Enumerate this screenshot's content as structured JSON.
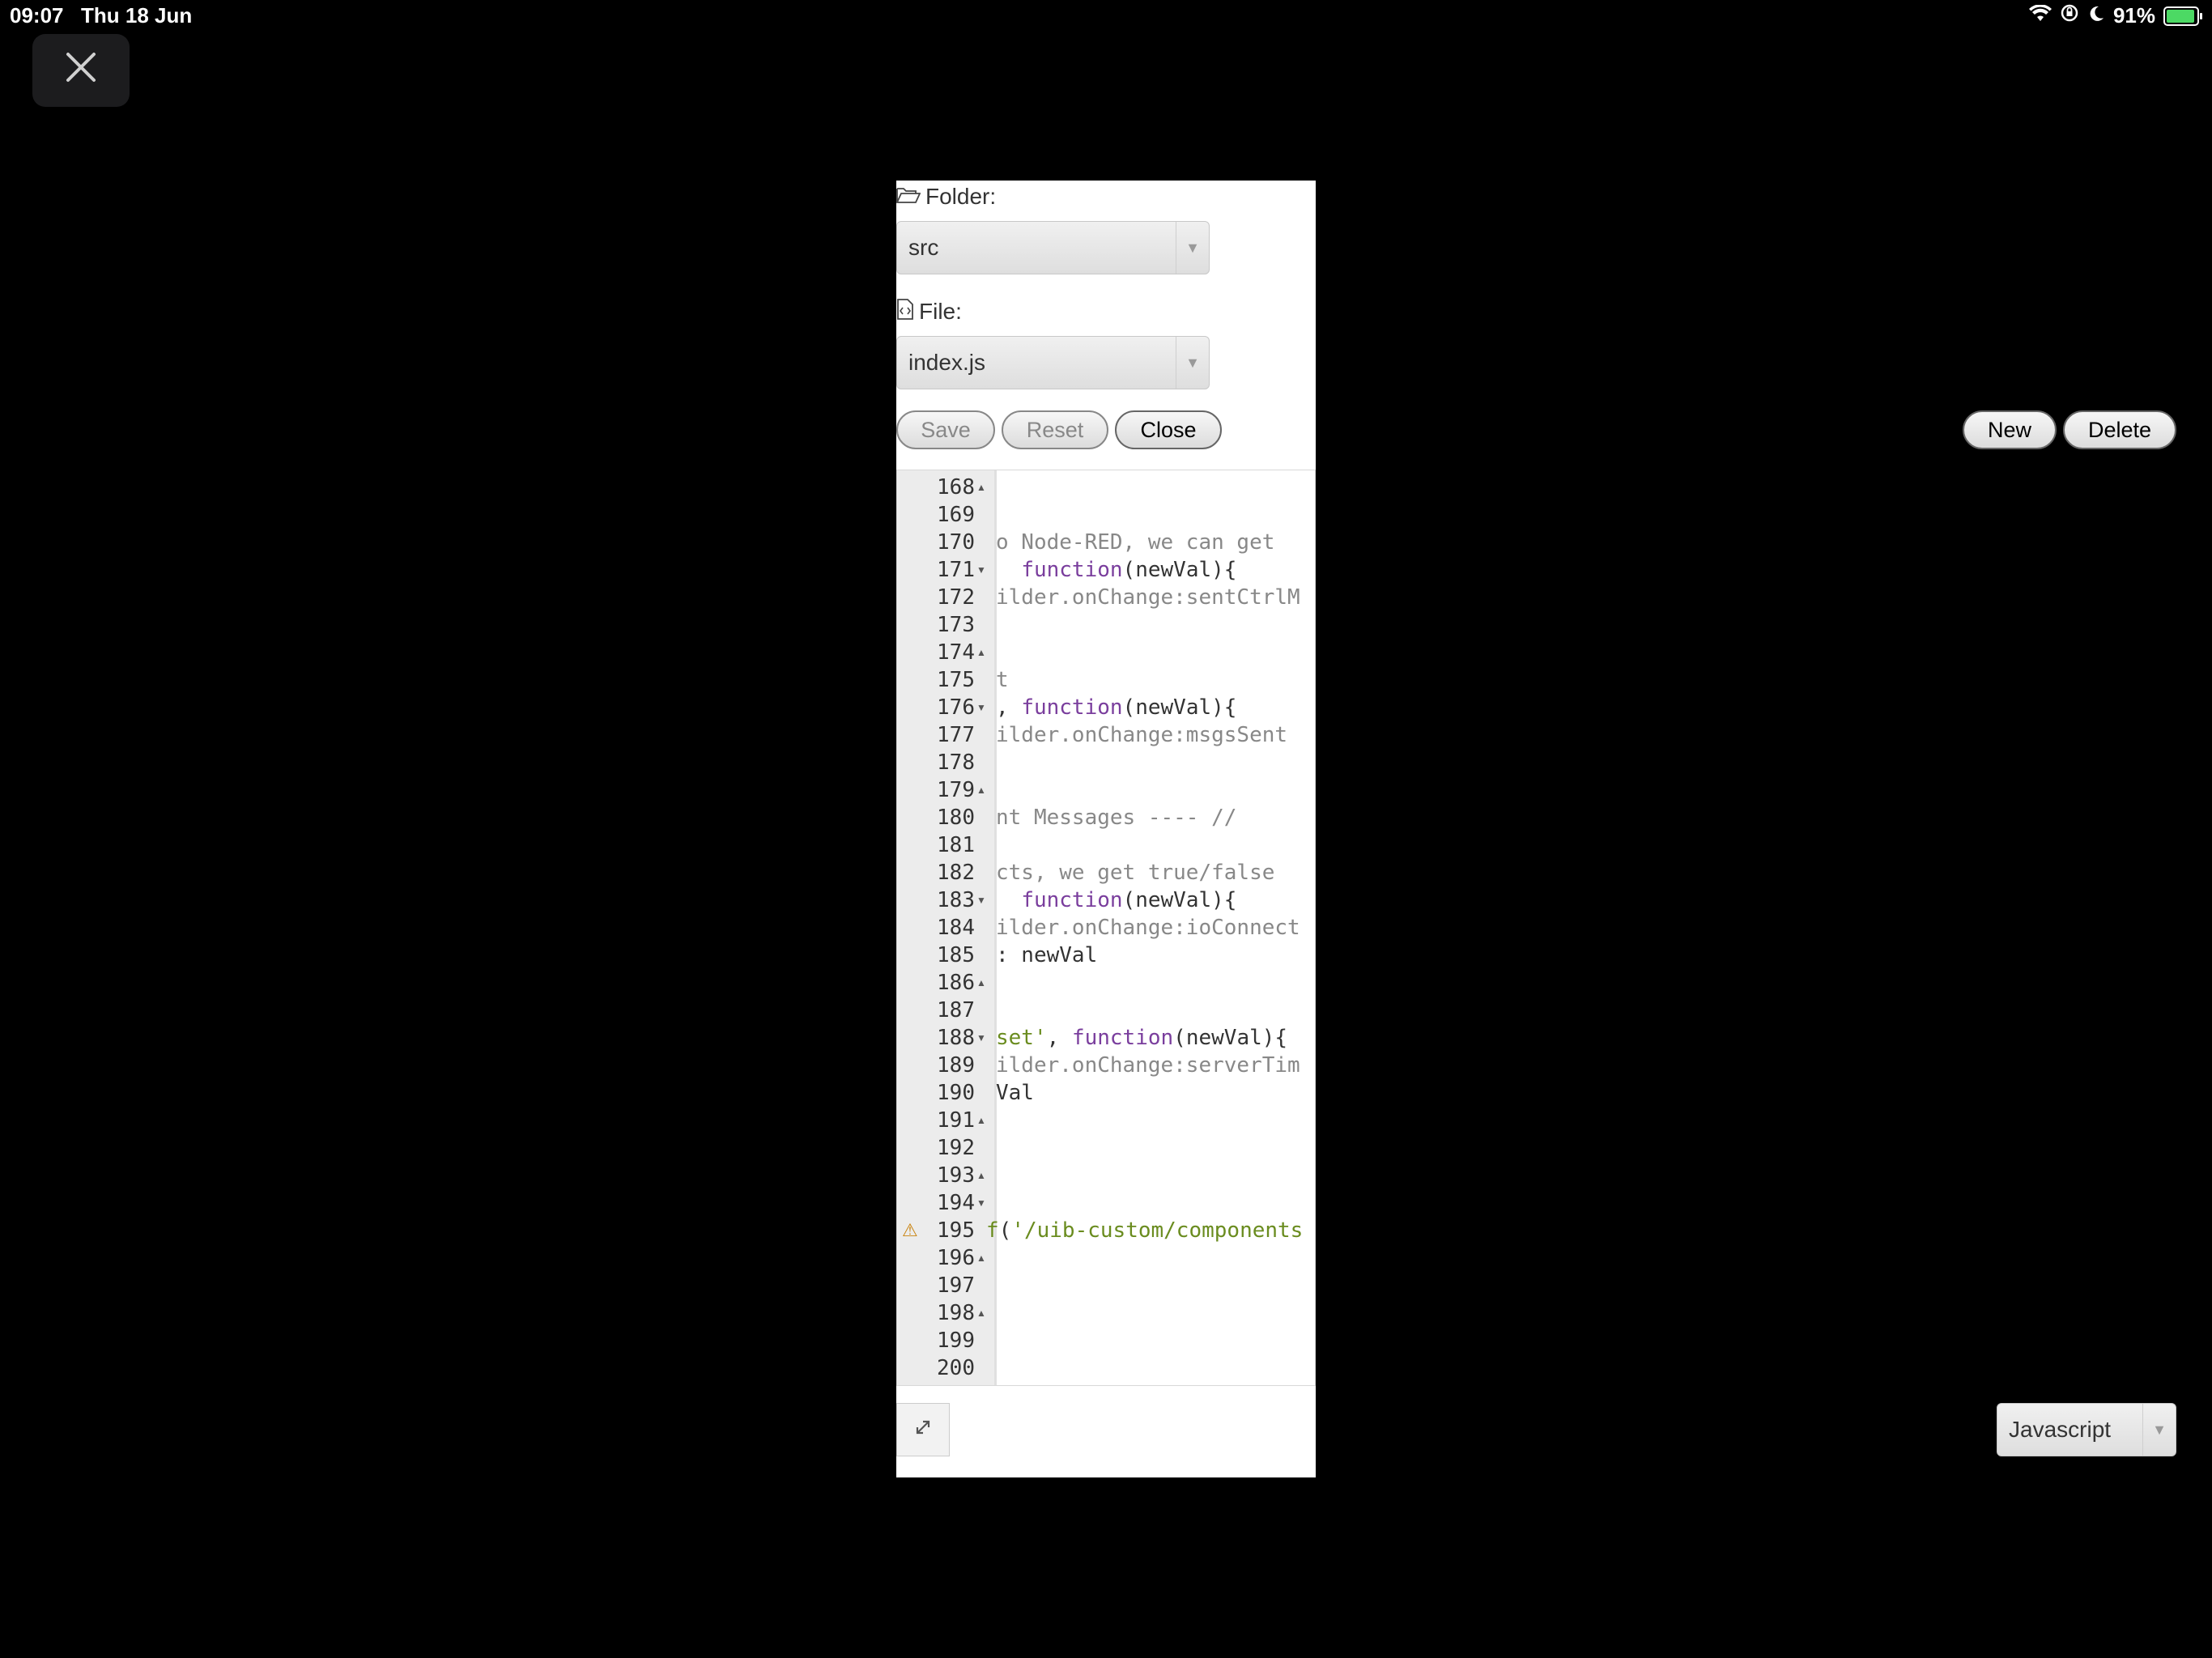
{
  "status_bar": {
    "time": "09:07",
    "date": "Thu 18 Jun",
    "battery": "91%",
    "icons": [
      "wifi-icon",
      "orientation-lock-icon",
      "moon-icon",
      "battery-charging-icon"
    ]
  },
  "overlay": {
    "close_icon": "close-icon"
  },
  "folder": {
    "label": "Folder:",
    "value": "src",
    "icon": "folder-open-icon"
  },
  "file": {
    "label": "File:",
    "value": "index.js",
    "icon": "code-file-icon"
  },
  "buttons": {
    "save": "Save",
    "reset": "Reset",
    "close": "Close",
    "new": "New",
    "delete": "Delete"
  },
  "language": {
    "value": "Javascript"
  },
  "editor": {
    "lines": [
      {
        "n": "168",
        "fold": "up",
        "text": "",
        "cls": ""
      },
      {
        "n": "169",
        "fold": "",
        "text": "",
        "cls": ""
      },
      {
        "n": "170",
        "fold": "",
        "text": "o Node-RED, we can get ",
        "cls": "comment"
      },
      {
        "n": "171",
        "fold": "down",
        "text": "",
        "cls": "fn",
        "pre": "  ",
        "kw": "function",
        "post": "(newVal){"
      },
      {
        "n": "172",
        "fold": "",
        "text": "ilder.onChange:sentCtrlM",
        "cls": "comment"
      },
      {
        "n": "173",
        "fold": "",
        "text": "",
        "cls": ""
      },
      {
        "n": "174",
        "fold": "up",
        "text": "",
        "cls": ""
      },
      {
        "n": "175",
        "fold": "",
        "text": "t",
        "cls": "comment"
      },
      {
        "n": "176",
        "fold": "down",
        "text": "",
        "cls": "fn",
        "pre": ", ",
        "kw": "function",
        "post": "(newVal){"
      },
      {
        "n": "177",
        "fold": "",
        "text": "ilder.onChange:msgsSent",
        "cls": "comment"
      },
      {
        "n": "178",
        "fold": "",
        "text": "",
        "cls": ""
      },
      {
        "n": "179",
        "fold": "up",
        "text": "",
        "cls": ""
      },
      {
        "n": "180",
        "fold": "",
        "text": "nt Messages ---- //",
        "cls": "comment"
      },
      {
        "n": "181",
        "fold": "",
        "text": "",
        "cls": ""
      },
      {
        "n": "182",
        "fold": "",
        "text": "cts, we get true/false ",
        "cls": "comment"
      },
      {
        "n": "183",
        "fold": "down",
        "text": "",
        "cls": "fn",
        "pre": "  ",
        "kw": "function",
        "post": "(newVal){"
      },
      {
        "n": "184",
        "fold": "",
        "text": "ilder.onChange:ioConnect",
        "cls": "comment"
      },
      {
        "n": "185",
        "fold": "",
        "text": ": newVal",
        "cls": "plain"
      },
      {
        "n": "186",
        "fold": "up",
        "text": "",
        "cls": ""
      },
      {
        "n": "187",
        "fold": "",
        "text": "",
        "cls": ""
      },
      {
        "n": "188",
        "fold": "down",
        "text": "",
        "cls": "fnstr",
        "str": "set'",
        "pre": ", ",
        "kw": "function",
        "post": "(newVal){"
      },
      {
        "n": "189",
        "fold": "",
        "text": "ilder.onChange:serverTim",
        "cls": "comment"
      },
      {
        "n": "190",
        "fold": "",
        "text": "Val",
        "cls": "plain"
      },
      {
        "n": "191",
        "fold": "up",
        "text": "",
        "cls": ""
      },
      {
        "n": "192",
        "fold": "",
        "text": "",
        "cls": ""
      },
      {
        "n": "193",
        "fold": "up",
        "text": "",
        "cls": ""
      },
      {
        "n": "194",
        "fold": "down",
        "text": "",
        "cls": ""
      },
      {
        "n": "195",
        "fold": "",
        "text": "",
        "cls": "str2",
        "warn": true,
        "pre": "(",
        "str": "'/uib-custom/components"
      },
      {
        "n": "196",
        "fold": "up",
        "text": "",
        "cls": ""
      },
      {
        "n": "197",
        "fold": "",
        "text": "",
        "cls": ""
      },
      {
        "n": "198",
        "fold": "up",
        "text": "",
        "cls": ""
      },
      {
        "n": "199",
        "fold": "",
        "text": "",
        "cls": ""
      },
      {
        "n": "200",
        "fold": "",
        "text": "",
        "cls": ""
      }
    ]
  }
}
